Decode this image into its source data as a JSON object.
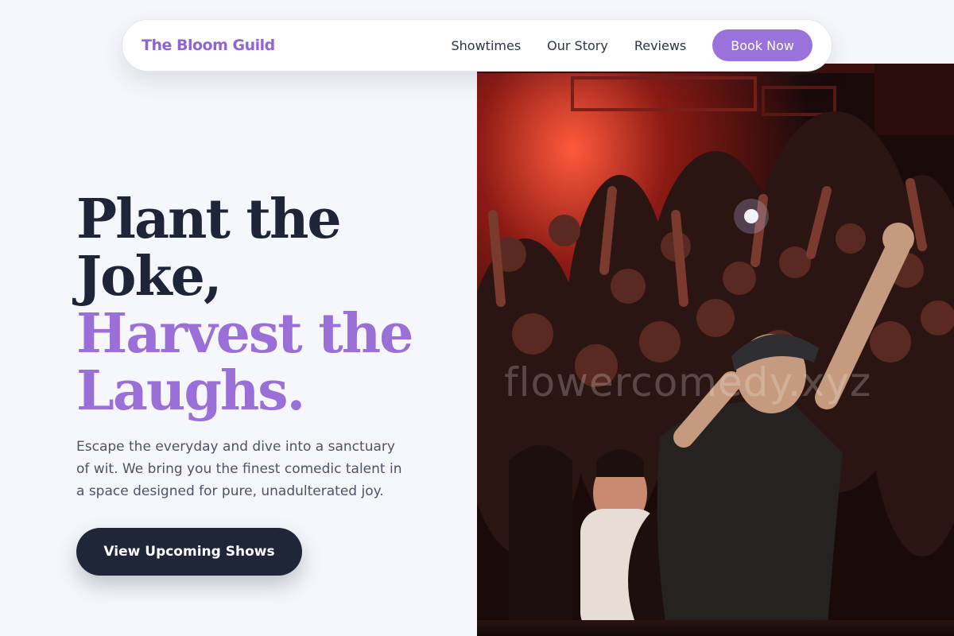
{
  "nav": {
    "brand": "The Bloom Guild",
    "links": [
      "Showtimes",
      "Our Story",
      "Reviews"
    ],
    "cta": "Book Now"
  },
  "hero": {
    "headline_line1": "Plant the",
    "headline_line2": "Joke,",
    "headline_line3": "Harvest the",
    "headline_line4": "Laughs.",
    "subtitle": "Escape the everyday and dive into a sanctuary of wit. We bring you the finest comedic talent in a space designed for pure, unadulterated joy.",
    "cta": "View Upcoming Shows",
    "image_watermark": "flowercomedy.xyz",
    "image_subject": "comedian-performing-to-crowd-photo"
  },
  "colors": {
    "accent": "#9b6fd8",
    "dark": "#1e2538",
    "background": "#f6f7fc",
    "button_purple": "#9a72dc"
  }
}
